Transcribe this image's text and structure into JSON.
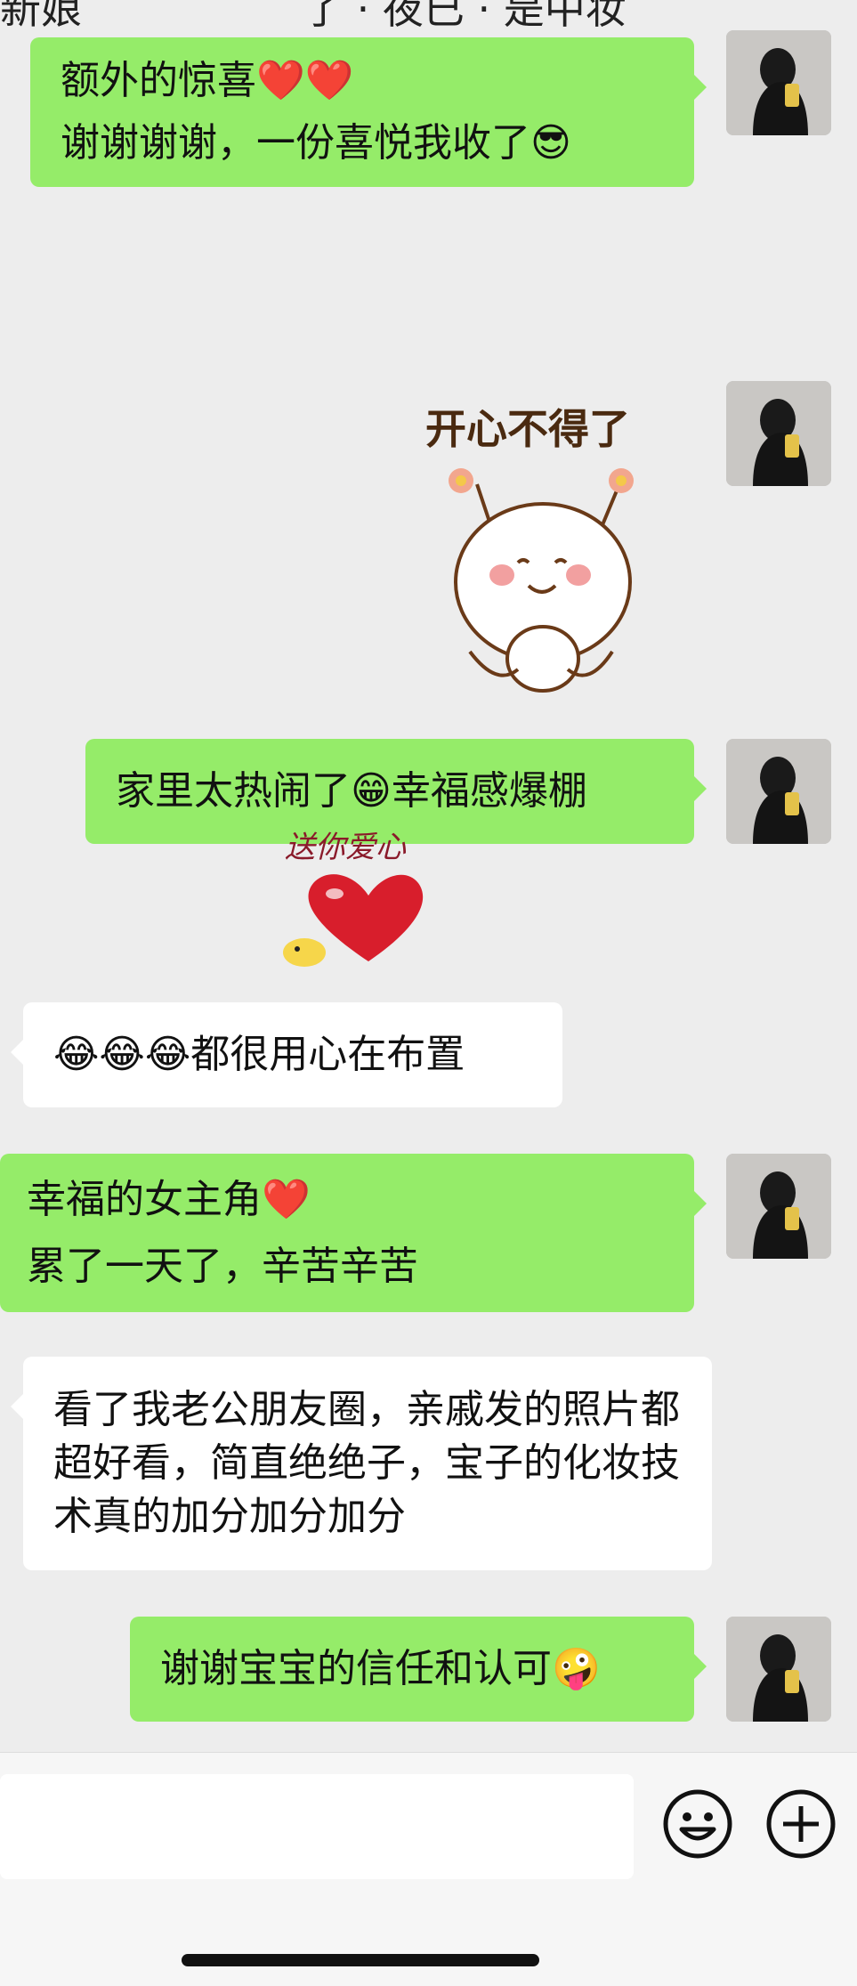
{
  "header": {
    "title_left_fragment": "新娘",
    "title_right_fragment": "了 · 夜已 · 是中妆"
  },
  "messages": [
    {
      "side": "right",
      "segments": [
        {
          "text": "额外的惊喜"
        },
        {
          "emoji": "❤️"
        },
        {
          "emoji": "❤️"
        },
        {
          "text": "谢谢谢谢，一份喜悦我收了"
        },
        {
          "emoji": "😎"
        }
      ]
    },
    {
      "side": "right",
      "sticker": "happy-bun-sticker",
      "caption": "开心不得了"
    },
    {
      "side": "right",
      "segments": [
        {
          "text": "家里太热闹了"
        },
        {
          "emoji": "😁"
        },
        {
          "text": "幸福感爆棚"
        }
      ]
    },
    {
      "side": "left",
      "sticker": "heart-sticker",
      "caption": "送你爱心"
    },
    {
      "side": "left",
      "segments": [
        {
          "emoji": "😂"
        },
        {
          "emoji": "😂"
        },
        {
          "emoji": "😂"
        },
        {
          "text": "都很用心在布置"
        }
      ]
    },
    {
      "side": "right",
      "segments": [
        {
          "text": "幸福的女主角"
        },
        {
          "emoji": "❤️"
        },
        {
          "text": "累了一天了，辛苦辛苦"
        }
      ]
    },
    {
      "side": "left",
      "segments": [
        {
          "text": "看了我老公朋友圈，亲戚发的照片都超好看，简直绝绝子，宝子的化妆技术真的加分加分加分"
        }
      ]
    },
    {
      "side": "right",
      "segments": [
        {
          "text": "谢谢宝宝的信任和认可"
        },
        {
          "emoji": "🤪"
        }
      ]
    }
  ],
  "input_bar": {
    "icons": [
      "emoji-icon",
      "plus-icon"
    ]
  },
  "colors": {
    "background": "#ededed",
    "bubble_self": "#95ec69",
    "bubble_other": "#ffffff"
  }
}
